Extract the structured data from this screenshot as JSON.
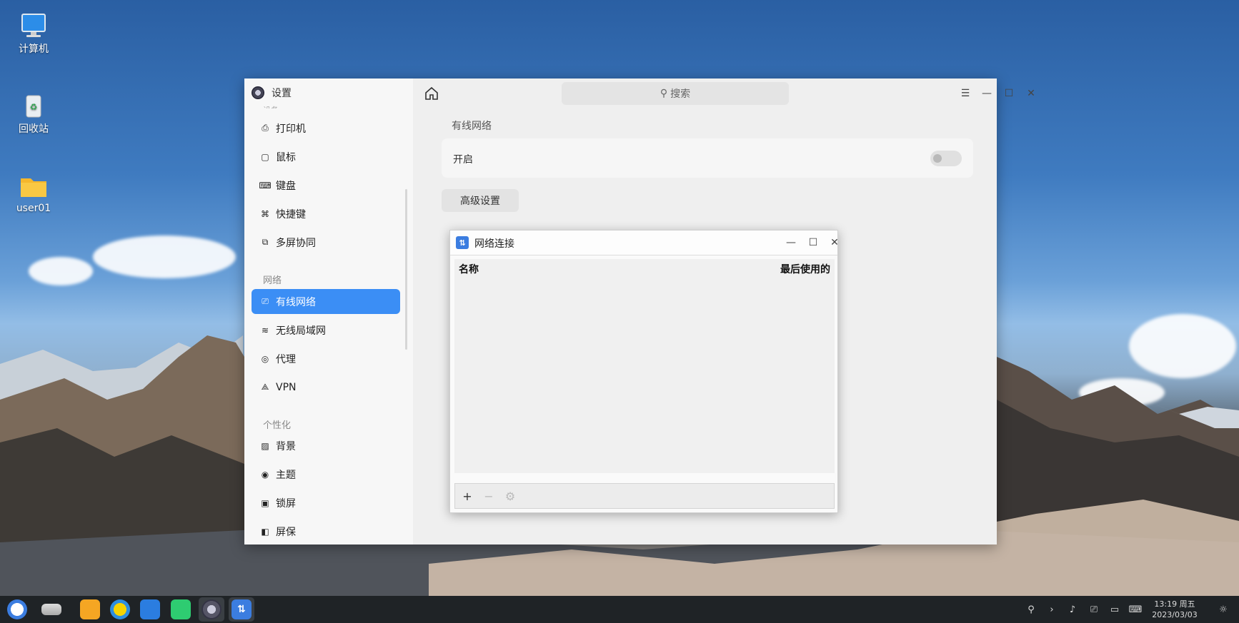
{
  "desktop": {
    "icons": [
      {
        "label": "计算机",
        "icon": "computer-icon"
      },
      {
        "label": "回收站",
        "icon": "trash-icon"
      },
      {
        "label": "user01",
        "icon": "home-folder-icon"
      }
    ]
  },
  "settings": {
    "title": "设置",
    "search_placeholder": "搜索",
    "sidebar": {
      "partial_group": "设备",
      "items_device": [
        "打印机",
        "鼠标",
        "键盘",
        "快捷键",
        "多屏协同"
      ],
      "group_network": "网络",
      "items_network": [
        "有线网络",
        "无线局域网",
        "代理",
        "VPN"
      ],
      "group_personal": "个性化",
      "items_personal": [
        "背景",
        "主题",
        "锁屏",
        "屏保"
      ],
      "selected": "有线网络"
    },
    "content": {
      "section_title": "有线网络",
      "enable_label": "开启",
      "enable_state": false,
      "advanced_button": "高级设置"
    }
  },
  "dialog": {
    "title": "网络连接",
    "columns": [
      "名称",
      "最后使用的"
    ],
    "footer_buttons": [
      "+",
      "−",
      "⚙"
    ]
  },
  "taskbar": {
    "time": "13:19 周五",
    "date": "2023/03/03"
  },
  "colors": {
    "accent": "#3b8ef5"
  }
}
